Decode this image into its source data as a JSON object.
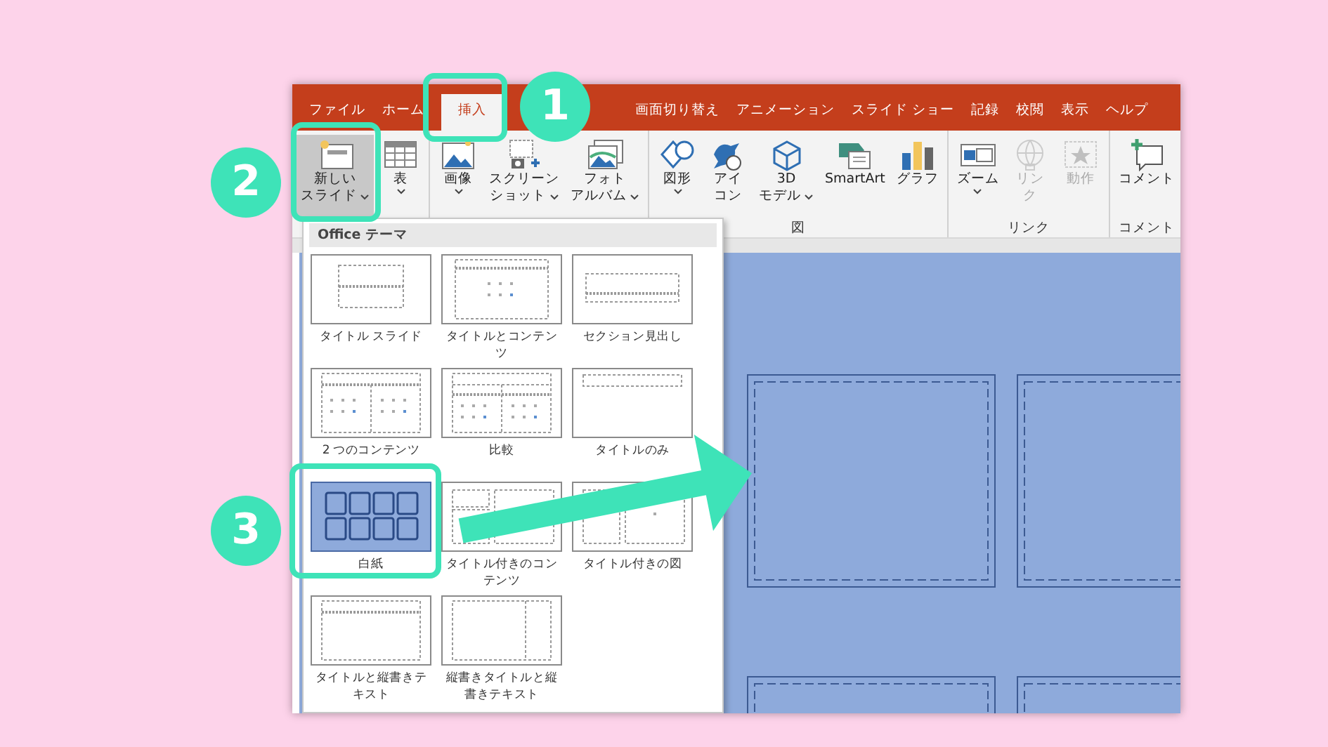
{
  "tabs": [
    {
      "label": "ファイル",
      "selected": false
    },
    {
      "label": "ホーム",
      "selected": false
    },
    {
      "label": "挿入",
      "selected": true
    },
    {
      "label": "画面切り替え",
      "selected": false
    },
    {
      "label": "アニメーション",
      "selected": false
    },
    {
      "label": "スライド ショー",
      "selected": false
    },
    {
      "label": "記録",
      "selected": false
    },
    {
      "label": "校閲",
      "selected": false
    },
    {
      "label": "表示",
      "selected": false
    },
    {
      "label": "ヘルプ",
      "selected": false
    }
  ],
  "ribbon_groups": [
    {
      "buttons": [
        {
          "kind": "new_slide",
          "lines": [
            "新しい",
            "スライド"
          ],
          "caret": true,
          "pressed": true,
          "disabled": false
        },
        {
          "kind": "table",
          "lines": [
            "表"
          ],
          "caret": true,
          "pressed": false,
          "disabled": false
        }
      ]
    },
    {
      "buttons": [
        {
          "kind": "picture",
          "lines": [
            "画像"
          ],
          "caret": true,
          "pressed": false,
          "disabled": false
        },
        {
          "kind": "screenshot",
          "lines": [
            "スクリーン",
            "ショット"
          ],
          "caret": true,
          "pressed": false,
          "disabled": false
        },
        {
          "kind": "album",
          "lines": [
            "フォト",
            "アルバム"
          ],
          "caret": true,
          "pressed": false,
          "disabled": false
        }
      ]
    },
    {
      "label": "図",
      "buttons": [
        {
          "kind": "shapes",
          "lines": [
            "図形"
          ],
          "caret": true,
          "pressed": false,
          "disabled": false
        },
        {
          "kind": "icons",
          "lines": [
            "アイ",
            "コン"
          ],
          "caret": false,
          "pressed": false,
          "disabled": false
        },
        {
          "kind": "model3d",
          "lines": [
            "3D",
            "モデル"
          ],
          "caret": true,
          "pressed": false,
          "disabled": false
        },
        {
          "kind": "smartart",
          "lines": [
            "SmartArt"
          ],
          "caret": false,
          "pressed": false,
          "disabled": false
        },
        {
          "kind": "chart",
          "lines": [
            "グラフ"
          ],
          "caret": false,
          "pressed": false,
          "disabled": false
        }
      ]
    },
    {
      "label": "リンク",
      "buttons": [
        {
          "kind": "zoom",
          "lines": [
            "ズーム"
          ],
          "caret": true,
          "pressed": false,
          "disabled": false
        },
        {
          "kind": "link",
          "lines": [
            "リン",
            "ク"
          ],
          "caret": false,
          "pressed": false,
          "disabled": true
        },
        {
          "kind": "action",
          "lines": [
            "動作"
          ],
          "caret": false,
          "pressed": false,
          "disabled": true
        }
      ]
    },
    {
      "label": "コメント",
      "buttons": [
        {
          "kind": "comment",
          "lines": [
            "コメント"
          ],
          "caret": false,
          "pressed": false,
          "disabled": false
        }
      ]
    }
  ],
  "layout_gallery": {
    "header": "Office テーマ",
    "layouts": [
      {
        "kind": "title",
        "label": "タイトル スライド",
        "selected": false
      },
      {
        "kind": "title_content",
        "label": "タイトルとコンテンツ",
        "selected": false
      },
      {
        "kind": "section",
        "label": "セクション見出し",
        "selected": false
      },
      {
        "kind": "two_content",
        "label": "2 つのコンテンツ",
        "selected": false
      },
      {
        "kind": "comparison",
        "label": "比較",
        "selected": false
      },
      {
        "kind": "title_only",
        "label": "タイトルのみ",
        "selected": false
      },
      {
        "kind": "blank",
        "label": "白紙",
        "selected": true
      },
      {
        "kind": "content_caption",
        "label": "タイトル付きのコンテンツ",
        "selected": false
      },
      {
        "kind": "picture_caption",
        "label": "タイトル付きの図",
        "selected": false
      },
      {
        "kind": "vertical_text",
        "label": "タイトルと縦書きテキスト",
        "selected": false
      },
      {
        "kind": "vertical_title",
        "label": "縦書きタイトルと縦書きテキスト",
        "selected": false
      }
    ]
  },
  "callouts": [
    {
      "number": "1"
    },
    {
      "number": "2"
    },
    {
      "number": "3"
    }
  ]
}
